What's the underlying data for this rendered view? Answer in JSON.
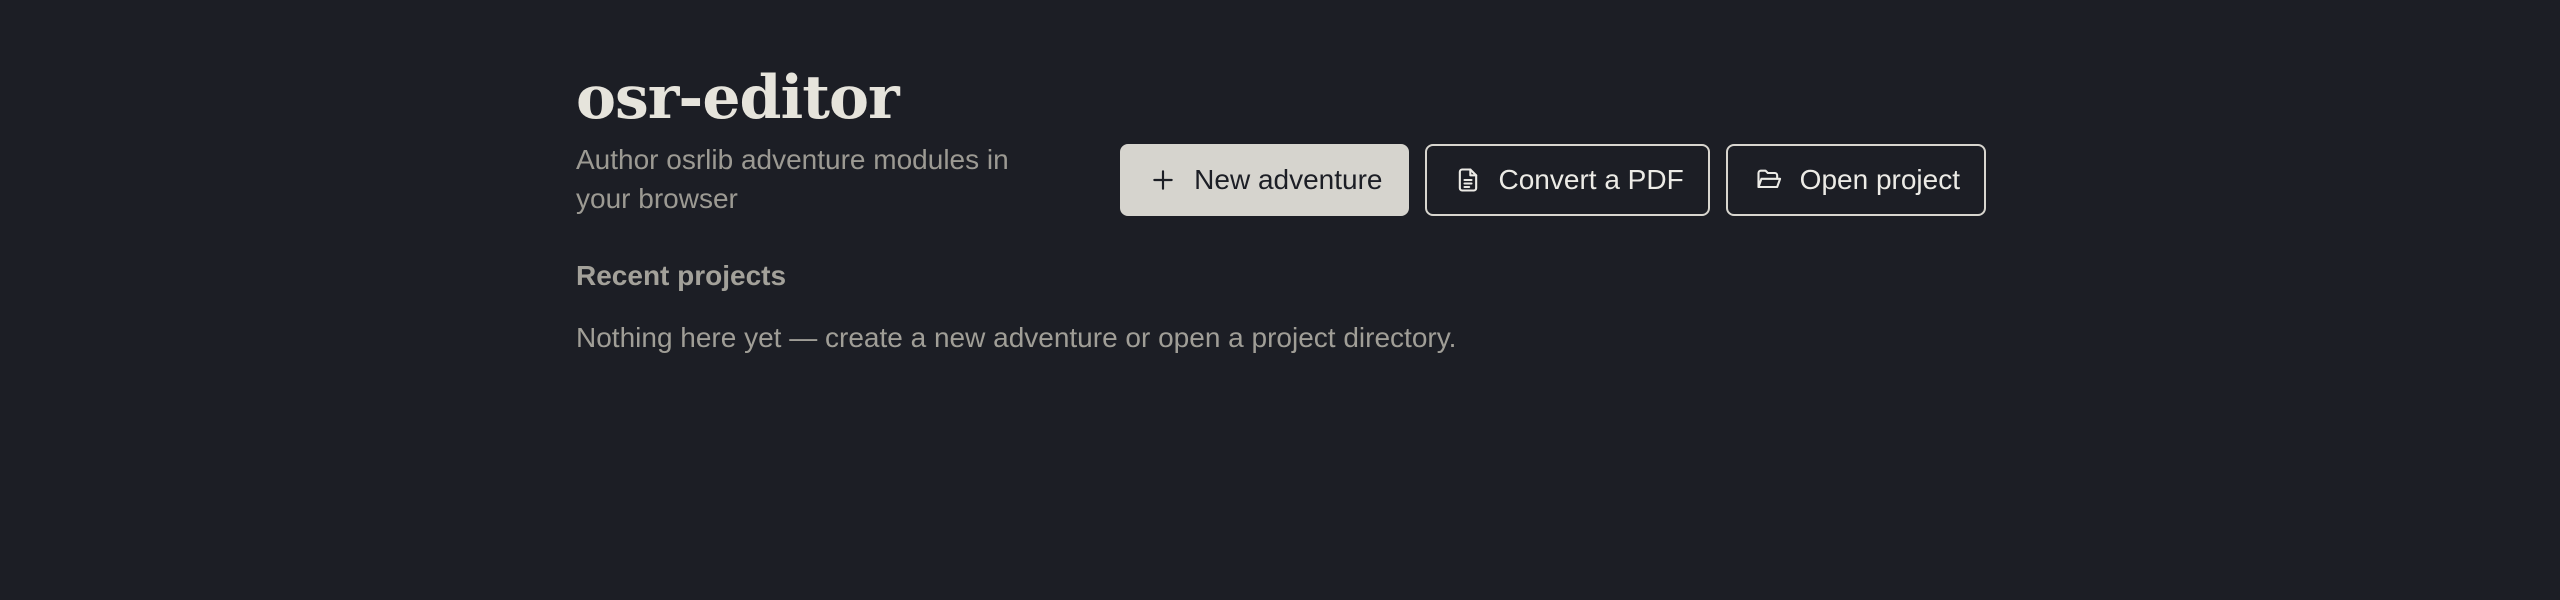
{
  "app": {
    "title": "osr-editor",
    "subtitle": "Author osrlib adventure modules in your browser"
  },
  "actions": {
    "new_adventure": {
      "label": "New adventure",
      "icon": "plus-icon"
    },
    "convert_pdf": {
      "label": "Convert a PDF",
      "icon": "document-icon"
    },
    "open_project": {
      "label": "Open project",
      "icon": "folder-open-icon"
    }
  },
  "recent": {
    "heading": "Recent projects",
    "empty_message": "Nothing here yet — create a new adventure or open a project directory."
  },
  "colors": {
    "background": "#1c1e25",
    "primary_button": "#d6d4ce",
    "text_primary": "#e6e4dc",
    "text_muted": "#9c9a93"
  }
}
